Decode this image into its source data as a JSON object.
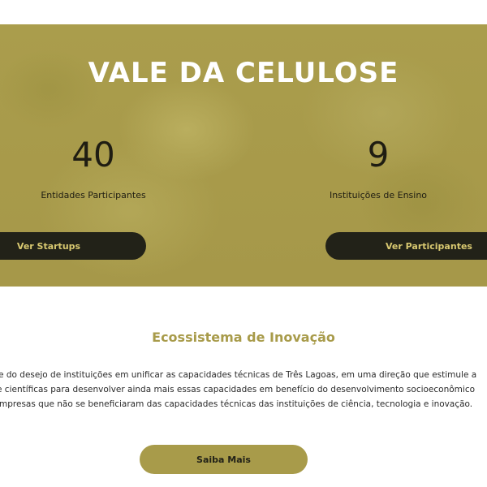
{
  "hero": {
    "title": "VALE DA CELULOSE",
    "stats": [
      {
        "value": "40",
        "label": "Entidades Participantes"
      },
      {
        "value": "9",
        "label": "Instituições de Ensino"
      }
    ],
    "buttons": {
      "startups": "Ver Startups",
      "participantes": "Ver Participantes"
    }
  },
  "ecosystem": {
    "title": "Ecossistema de Inovação",
    "paragraph_lines": [
      "re do desejo de instituições em unificar as capacidades técnicas de Três Lagoas, em uma direção que estimule a",
      "e científicas para desenvolver ainda mais essas capacidades em benefício do desenvolvimento socioeconômico",
      "mpresas que não se beneficiaram das capacidades técnicas das instituições de ciência, tecnologia e inovação."
    ],
    "button": "Saiba Mais"
  },
  "colors": {
    "accent": "#a89b4a",
    "dark": "#222218",
    "button_text": "#d8c870"
  }
}
